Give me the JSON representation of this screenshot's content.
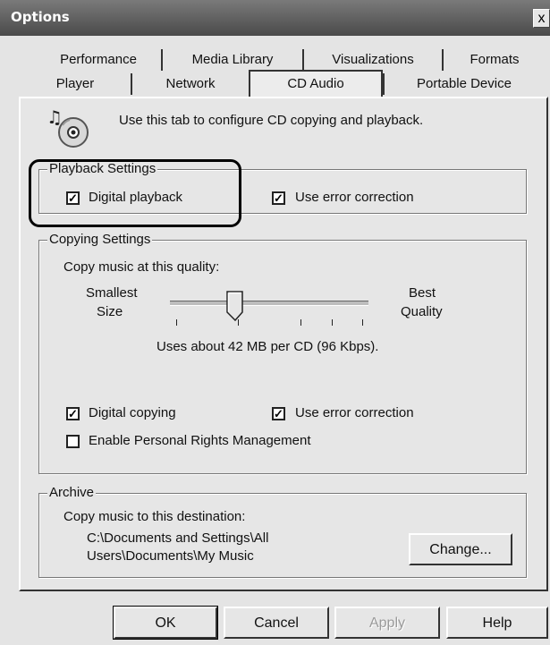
{
  "window": {
    "title": "Options",
    "close_symbol": "x"
  },
  "tabs": {
    "row1": [
      "Performance",
      "Media Library",
      "Visualizations",
      "Formats"
    ],
    "row2": [
      "Player",
      "Network",
      "CD Audio",
      "Portable Device"
    ],
    "active": "CD Audio"
  },
  "header": {
    "icon": "cd-music-icon",
    "description": "Use this tab to configure CD copying and playback."
  },
  "playback": {
    "legend": "Playback Settings",
    "digital_playback": {
      "label": "Digital playback",
      "checked": true
    },
    "error_correction": {
      "label": "Use error correction",
      "checked": true
    }
  },
  "copying": {
    "legend": "Copying Settings",
    "quality_label": "Copy music at this quality:",
    "slider_left_label_1": "Smallest",
    "slider_left_label_2": "Size",
    "slider_right_label_1": "Best",
    "slider_right_label_2": "Quality",
    "slider_value_fraction": 0.33,
    "slider_ticks": 5,
    "usage_text": "Uses about 42 MB per CD (96 Kbps).",
    "digital_copying": {
      "label": "Digital copying",
      "checked": true
    },
    "error_correction": {
      "label": "Use error correction",
      "checked": true
    },
    "prm": {
      "label": "Enable Personal Rights Management",
      "checked": false
    }
  },
  "archive": {
    "legend": "Archive",
    "destination_label": "Copy music to this destination:",
    "path_line1": "C:\\Documents and Settings\\All",
    "path_line2": "Users\\Documents\\My Music",
    "change_button": "Change..."
  },
  "buttons": {
    "ok": "OK",
    "cancel": "Cancel",
    "apply": "Apply",
    "help": "Help"
  },
  "colors": {
    "titlebar": "#5a5a5a",
    "dialog_bg": "#e4e4e4",
    "annotation_ring": "#000000"
  }
}
